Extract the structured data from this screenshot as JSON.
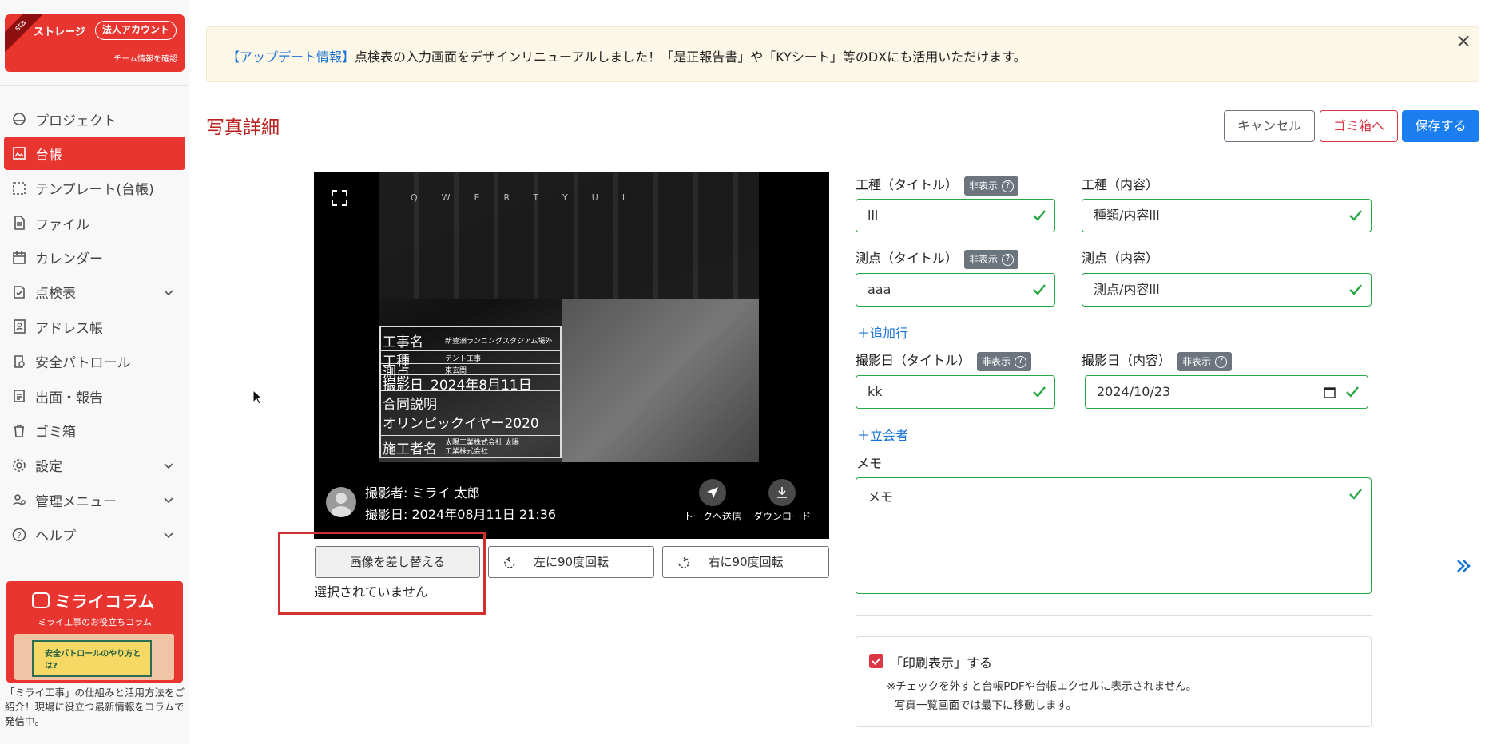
{
  "sidebar": {
    "ribbon": "sta",
    "brand_storage": "ストレージ",
    "brand_account": "法人アカウント",
    "brand_team_link": "チーム情報を確認",
    "items": [
      {
        "label": "プロジェクト",
        "icon": "project-icon",
        "active": false
      },
      {
        "label": "台帳",
        "icon": "ledger-icon",
        "active": true
      },
      {
        "label": "テンプレート(台帳)",
        "icon": "template-icon",
        "active": false
      },
      {
        "label": "ファイル",
        "icon": "file-icon",
        "active": false
      },
      {
        "label": "カレンダー",
        "icon": "calendar-icon",
        "active": false
      },
      {
        "label": "点検表",
        "icon": "checklist-icon",
        "active": false,
        "chevron": true
      },
      {
        "label": "アドレス帳",
        "icon": "address-book-icon",
        "active": false
      },
      {
        "label": "安全パトロール",
        "icon": "safety-patrol-icon",
        "active": false
      },
      {
        "label": "出面・報告",
        "icon": "report-icon",
        "active": false
      },
      {
        "label": "ゴミ箱",
        "icon": "trash-icon",
        "active": false
      },
      {
        "label": "設定",
        "icon": "gear-icon",
        "active": false,
        "chevron": true
      },
      {
        "label": "管理メニュー",
        "icon": "admin-icon",
        "active": false,
        "chevron": true
      },
      {
        "label": "ヘルプ",
        "icon": "help-icon",
        "active": false,
        "chevron": true
      }
    ],
    "column": {
      "title": "ミライコラム",
      "subtitle": "ミライ工事のお役立ちコラム",
      "art_text": "安全パトロールのやり方とは?",
      "description": "「ミライ工事」の仕組みと活用方法をご紹介！現場に役立つ最新情報をコラムで発信中。"
    }
  },
  "banner": {
    "link_text": "【アップデート情報】",
    "text": "点検表の入力画面をデザインリニューアルしました！「是正報告書」や「KYシート」等のDXにも活用いただけます。",
    "close": "×"
  },
  "page": {
    "title": "写真詳細",
    "cancel_label": "キャンセル",
    "trash_label": "ゴミ箱へ",
    "save_label": "保存する"
  },
  "photo": {
    "board": {
      "rows": [
        {
          "label": "工事名",
          "value": "新豊洲ランニングスタジアム場外"
        },
        {
          "label": "工種",
          "value": "テント工事"
        },
        {
          "label": "測点",
          "value": "東玄関"
        },
        {
          "label": "撮影日",
          "value": "2024年8月11日"
        },
        {
          "label": "合同説明",
          "value": ""
        },
        {
          "label": "オリンピックイヤー2020",
          "value": ""
        },
        {
          "label": "施工者名",
          "value": "太陽工業株式会社 太陽工業株式会社"
        }
      ]
    },
    "photographer": "撮影者: ミライ 太郎",
    "shot_at": "撮影日: 2024年08月11日 21:36",
    "send_talk_label": "トークへ送信",
    "download_label": "ダウンロード",
    "replace_label": "画像を差し替える",
    "rotate_left_label": "左に90度回転",
    "rotate_right_label": "右に90度回転",
    "file_status": "選択されていません"
  },
  "form": {
    "hide_badge": "非表示",
    "work_type_title_label": "工種（タイトル）",
    "work_type_title_value": "lll",
    "work_type_content_label": "工種（内容）",
    "work_type_content_value": "種類/内容lll",
    "station_title_label": "測点（タイトル）",
    "station_title_value": "aaa",
    "station_content_label": "測点（内容）",
    "station_content_value": "測点/内容lll",
    "add_row": "＋追加行",
    "date_title_label": "撮影日（タイトル）",
    "date_title_value": "kk",
    "date_content_label": "撮影日（内容）",
    "date_content_value": "2024/10/23",
    "add_witness": "＋立会者",
    "memo_label": "メモ",
    "memo_value": "メモ",
    "print_label": "「印刷表示」する",
    "print_note1": "※チェックを外すと台帳PDFや台帳エクセルに表示されません。",
    "print_note2": "写真一覧画面では最下に移動します。"
  },
  "colors": {
    "brand_red": "#e8352f",
    "title_red": "#b92020",
    "primary_blue": "#1a7ef0",
    "success_green": "#28a745",
    "danger": "#dc3545"
  }
}
